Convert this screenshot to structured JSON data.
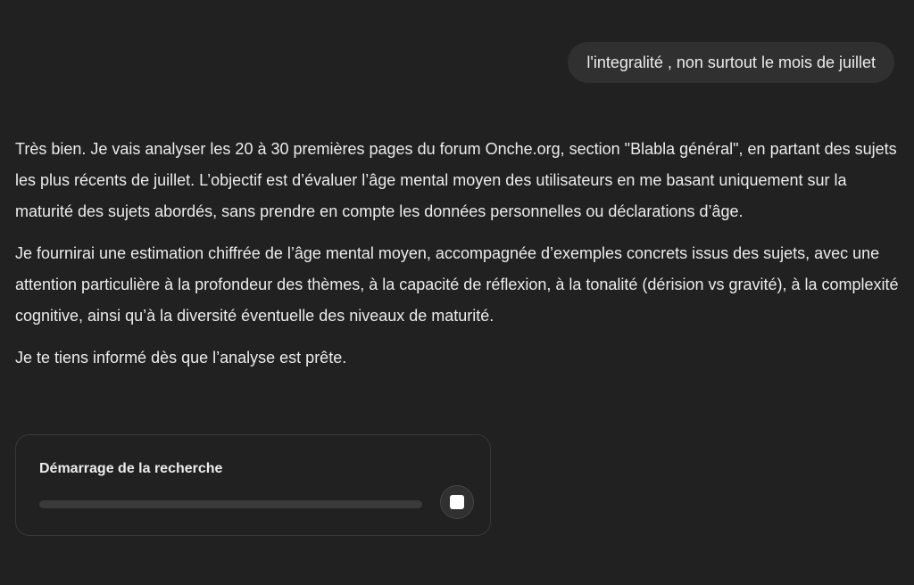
{
  "user_message": "l'integralité , non surtout le mois de juillet",
  "assistant": {
    "paragraphs": [
      "Très bien. Je vais analyser les 20 à 30 premières pages du forum Onche.org, section \"Blabla général\", en partant des sujets les plus récents de juillet. L’objectif est d’évaluer l’âge mental moyen des utilisateurs en me basant uniquement sur la maturité des sujets abordés, sans prendre en compte les données personnelles ou déclarations d’âge.",
      "Je fournirai une estimation chiffrée de l’âge mental moyen, accompagnée d’exemples concrets issus des sujets, avec une attention particulière à la profondeur des thèmes, à la capacité de réflexion, à la tonalité (dérision vs gravité), à la complexité cognitive, ainsi qu’à la diversité éventuelle des niveaux de maturité.",
      "Je te tiens informé dès que l’analyse est prête."
    ]
  },
  "research_card": {
    "title": "Démarrage de la recherche",
    "progress": 0,
    "stop_icon": "stop-square-icon"
  },
  "colors": {
    "background": "#212121",
    "bubble": "#303030",
    "text": "#ececec"
  }
}
